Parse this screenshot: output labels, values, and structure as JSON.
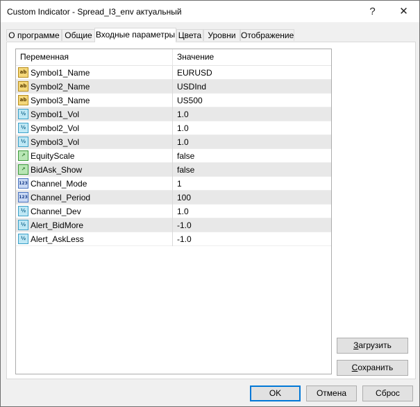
{
  "window": {
    "title": "Custom Indicator - Spread_I3_env актуальный",
    "help_label": "?",
    "close_label": "✕"
  },
  "tabs": [
    {
      "label": "О программе",
      "active": false
    },
    {
      "label": "Общие",
      "active": false
    },
    {
      "label": "Входные параметры",
      "active": true
    },
    {
      "label": "Цвета",
      "active": false
    },
    {
      "label": "Уровни",
      "active": false
    },
    {
      "label": "Отображение",
      "active": false
    }
  ],
  "grid": {
    "headers": {
      "variable": "Переменная",
      "value": "Значение"
    },
    "rows": [
      {
        "name": "Symbol1_Name",
        "value": "EURUSD",
        "type": "string",
        "icon": "ab"
      },
      {
        "name": "Symbol2_Name",
        "value": "USDInd",
        "type": "string",
        "icon": "ab"
      },
      {
        "name": "Symbol3_Name",
        "value": "US500",
        "type": "string",
        "icon": "ab"
      },
      {
        "name": "Symbol1_Vol",
        "value": "1.0",
        "type": "double",
        "icon": "½"
      },
      {
        "name": "Symbol2_Vol",
        "value": "1.0",
        "type": "double",
        "icon": "½"
      },
      {
        "name": "Symbol3_Vol",
        "value": "1.0",
        "type": "double",
        "icon": "½"
      },
      {
        "name": "EquityScale",
        "value": "false",
        "type": "bool",
        "icon": "↗"
      },
      {
        "name": "BidAsk_Show",
        "value": "false",
        "type": "bool",
        "icon": "↗"
      },
      {
        "name": "Channel_Mode",
        "value": "1",
        "type": "int",
        "icon": "123"
      },
      {
        "name": "Channel_Period",
        "value": "100",
        "type": "int",
        "icon": "123"
      },
      {
        "name": "Channel_Dev",
        "value": "1.0",
        "type": "double",
        "icon": "½"
      },
      {
        "name": "Alert_BidMore",
        "value": "-1.0",
        "type": "double",
        "icon": "½"
      },
      {
        "name": "Alert_AskLess",
        "value": "-1.0",
        "type": "double",
        "icon": "½"
      }
    ]
  },
  "buttons": {
    "load": {
      "accel": "З",
      "rest": "агрузить"
    },
    "save": {
      "accel": "С",
      "rest": "охранить"
    },
    "ok": "OK",
    "cancel": "Отмена",
    "reset": "Сброс"
  }
}
